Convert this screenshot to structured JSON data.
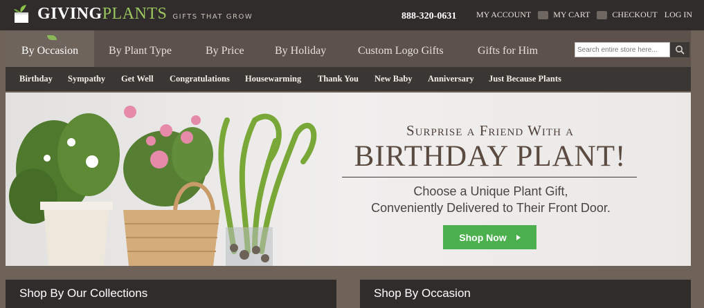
{
  "brand": {
    "name_part1": "GIVING",
    "name_part2": "PLANTS",
    "tagline": "GIFTS THAT GROW"
  },
  "header": {
    "phone": "888-320-0631",
    "links": [
      "MY ACCOUNT",
      "MY CART",
      "CHECKOUT",
      "LOG IN"
    ]
  },
  "main_nav": {
    "items": [
      "By Occasion",
      "By Plant Type",
      "By Price",
      "By Holiday",
      "Custom Logo Gifts",
      "Gifts for Him"
    ],
    "active_index": 0
  },
  "search": {
    "placeholder": "Search entire store here..."
  },
  "sub_nav": {
    "items": [
      "Birthday",
      "Sympathy",
      "Get Well",
      "Congratulations",
      "Housewarming",
      "Thank You",
      "New Baby",
      "Anniversary",
      "Just Because Plants"
    ]
  },
  "hero": {
    "headline_small": "Surprise a Friend With a",
    "headline_big": "BIRTHDAY PLANT!",
    "sub_line1": "Choose a Unique Plant Gift,",
    "sub_line2": "Conveniently Delivered to Their Front Door.",
    "cta": "Shop Now"
  },
  "sections": {
    "collections": "Shop By Our Collections",
    "occasion": "Shop By Occasion"
  },
  "colors": {
    "accent_green": "#4cb04f",
    "brand_green": "#9cc75f",
    "dark_bar": "#2f2c2b"
  }
}
